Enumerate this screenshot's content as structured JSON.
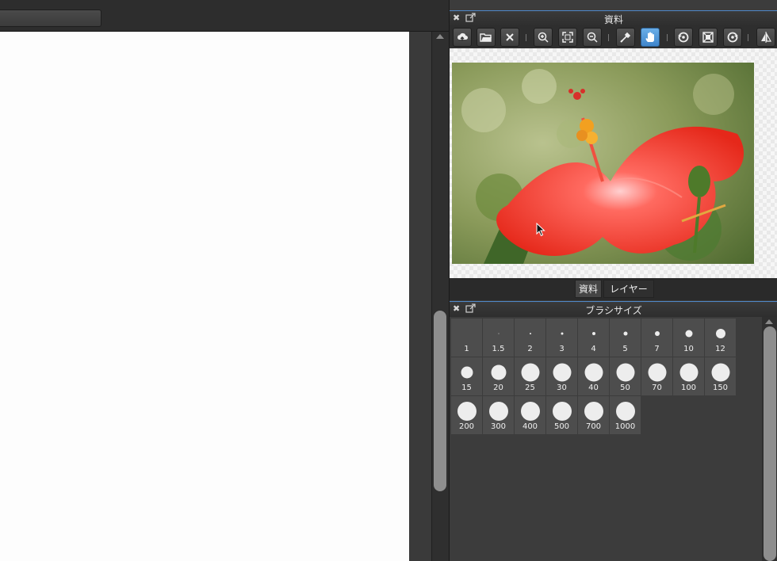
{
  "reference_panel": {
    "title": "資料",
    "toolbar": [
      {
        "icon": "cloud-upload-icon",
        "active": false
      },
      {
        "icon": "folder-open-icon",
        "active": false
      },
      {
        "icon": "close-icon",
        "active": false
      },
      {
        "icon": "zoom-in-icon",
        "active": false
      },
      {
        "icon": "fit-screen-icon",
        "active": false
      },
      {
        "icon": "zoom-out-icon",
        "active": false
      },
      {
        "icon": "eyedropper-icon",
        "active": false
      },
      {
        "icon": "hand-pan-icon",
        "active": true
      },
      {
        "icon": "rotate-left-icon",
        "active": false
      },
      {
        "icon": "fit-frame-icon",
        "active": false
      },
      {
        "icon": "rotate-right-icon",
        "active": false
      },
      {
        "icon": "flip-horizontal-icon",
        "active": false
      }
    ],
    "image": "red-hibiscus-flower-photo"
  },
  "tabs": [
    {
      "label": "資料",
      "selected": true
    },
    {
      "label": "レイヤー",
      "selected": false
    }
  ],
  "brush_panel": {
    "title": "ブラシサイズ",
    "sizes": [
      "1",
      "1.5",
      "2",
      "3",
      "4",
      "5",
      "7",
      "10",
      "12",
      "15",
      "20",
      "25",
      "30",
      "40",
      "50",
      "70",
      "100",
      "150",
      "200",
      "300",
      "400",
      "500",
      "700",
      "1000"
    ]
  },
  "colors": {
    "active_tool": "#4a94d8",
    "panel_border": "#4f88c8",
    "paper": "#fdfdfd"
  }
}
